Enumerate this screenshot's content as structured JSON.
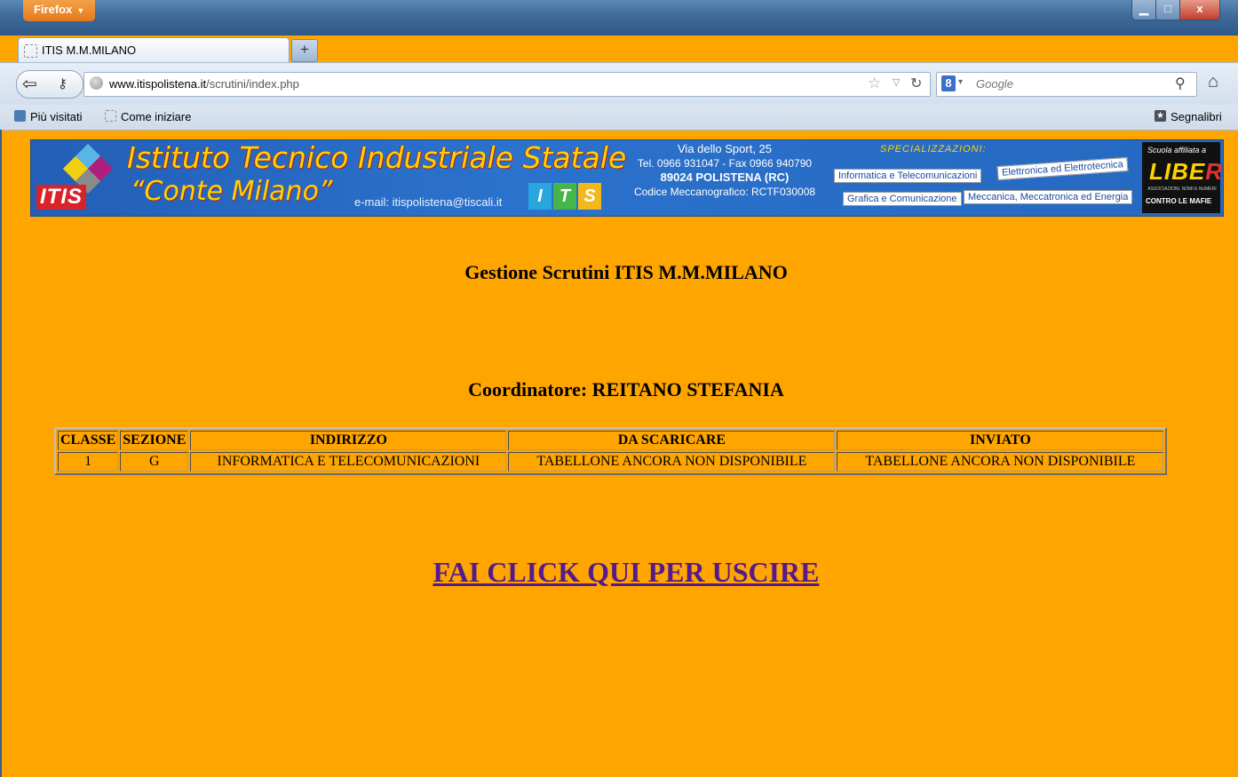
{
  "browser": {
    "menu_label": "Firefox",
    "tab_title": "ITIS M.M.MILANO",
    "url_domain": "www.itispolistena.it",
    "url_path": "/scrutini/index.php",
    "search_engine": "Google",
    "search_placeholder": "Google",
    "bookmarks": [
      "Più visitati",
      "Come iniziare"
    ],
    "bookmarks_menu": "Segnalibri"
  },
  "banner": {
    "title": "Istituto Tecnico Industriale Statale",
    "subtitle": "“Conte Milano”",
    "logo": "ITIS",
    "email": "e-mail: itispolistena@tiscali.it",
    "its": [
      "I",
      "T",
      "S"
    ],
    "address": "Via dello Sport, 25",
    "phone": "Tel. 0966 931047 - Fax 0966 940790",
    "city": "89024 POLISTENA (RC)",
    "code": "Codice Meccanografico: RCTF030008",
    "spec_header": "SPECIALIZZAZIONI:",
    "specializations": [
      "Informatica e Telecomunicazioni",
      "Elettronica ed Elettrotecnica",
      "Grafica e Comunicazione",
      "Meccanica, Meccatronica ed Energia"
    ],
    "libera_top": "Scuola affiliata a",
    "libera_name": "LIBERA",
    "libera_small": "ASSOCIAZIONI, NOMI E NUMERI",
    "libera_bottom": "CONTRO LE MAFIE"
  },
  "page": {
    "title": "Gestione Scrutini ITIS M.M.MILANO",
    "coordinator": "Coordinatore: REITANO STEFANIA",
    "table": {
      "headers": [
        "CLASSE",
        "SEZIONE",
        "INDIRIZZO",
        "DA SCARICARE",
        "INVIATO"
      ],
      "rows": [
        [
          "1",
          "G",
          "INFORMATICA E TELECOMUNICAZIONI",
          "TABELLONE ANCORA NON DISPONIBILE",
          "TABELLONE ANCORA NON DISPONIBILE"
        ]
      ]
    },
    "exit_link": "FAI CLICK QUI PER USCIRE"
  },
  "colors": {
    "page_bg": "#ffa500",
    "link": "#551a8b"
  }
}
